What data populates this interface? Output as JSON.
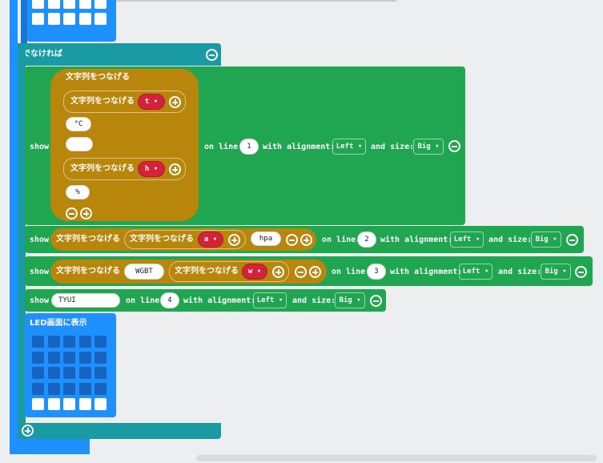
{
  "else_label": "でなければ",
  "join_label": "文字列をつなげる",
  "led_label": "LED画面に表示",
  "show": "show",
  "on_line": "on line",
  "with_alignment": "with alignment:",
  "and_size": "and size:",
  "alignment": "Left",
  "size": "Big",
  "block1": {
    "line": "1",
    "join1_var": "t",
    "str_c": "°C",
    "str_blank": "",
    "join2_var": "h",
    "str_pct": "%"
  },
  "block2": {
    "line": "2",
    "var": "a",
    "str": "hpa"
  },
  "block3": {
    "line": "3",
    "str": "WGBT",
    "var": "w"
  },
  "block4": {
    "line": "4",
    "str": "TYUI"
  },
  "colors": {
    "background": "#eceef0",
    "led_block": "#1e90ff",
    "logic_block": "#1a9ba3",
    "display_block": "#20a550",
    "text_block": "#b8860b",
    "variable": "#d6213b"
  }
}
